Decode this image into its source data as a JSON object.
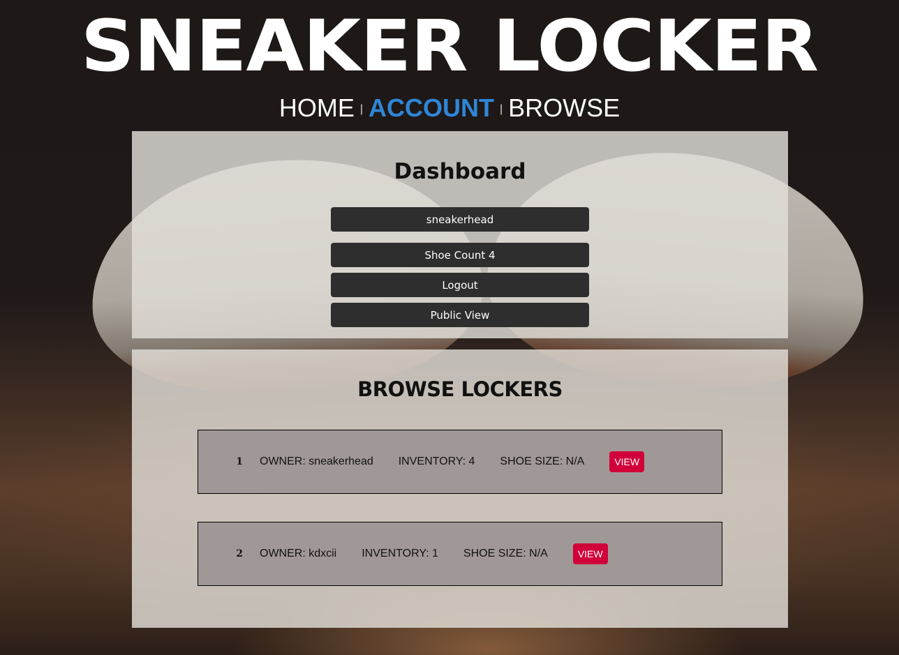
{
  "site": {
    "logo": "SNEAKER LOCKER"
  },
  "nav": {
    "items": [
      {
        "label": "HOME",
        "active": false
      },
      {
        "label": "ACCOUNT",
        "active": true
      },
      {
        "label": "BROWSE",
        "active": false
      }
    ],
    "separator": "|",
    "active_color": "#2f86d6"
  },
  "dashboard": {
    "title": "Dashboard",
    "buttons": [
      {
        "label": "sneakerhead"
      },
      {
        "label": "Shoe Count 4"
      },
      {
        "label": "Logout"
      },
      {
        "label": "Public View"
      }
    ]
  },
  "browse": {
    "title": "BROWSE LOCKERS",
    "lockers": [
      {
        "index": "1",
        "owner": "OWNER: sneakerhead",
        "inventory": "INVENTORY: 4",
        "shoe_size": "SHOE SIZE: N/A",
        "view_label": "VIEW"
      },
      {
        "index": "2",
        "owner": "OWNER: kdxcii",
        "inventory": "INVENTORY: 1",
        "shoe_size": "SHOE SIZE: N/A",
        "view_label": "VIEW"
      }
    ]
  },
  "colors": {
    "view_button": "#d1003a",
    "dash_button": "#2e2e2e",
    "locker_card": "#a09897"
  }
}
